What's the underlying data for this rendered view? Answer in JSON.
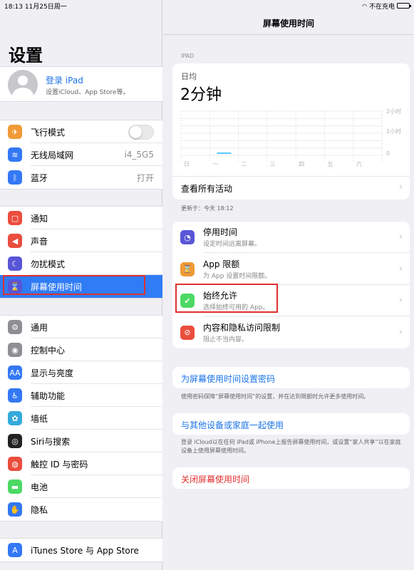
{
  "statusbar": {
    "time": "18:13",
    "date": "11月25日周一",
    "charging": "不在充电"
  },
  "sidebar": {
    "title": "设置",
    "profile": {
      "name": "登录 iPad",
      "subtitle": "设置iCloud、App Store等。"
    },
    "groups": [
      [
        {
          "label": "飞行模式",
          "icon": "airplane-icon",
          "color": "#f09a37",
          "glyph": "✈",
          "toggle": true
        },
        {
          "label": "无线局域网",
          "icon": "wifi-icon",
          "color": "#3478f6",
          "glyph": "≋",
          "value": "i4_5G5"
        },
        {
          "label": "蓝牙",
          "icon": "bluetooth-icon",
          "color": "#3478f6",
          "glyph": "ᛒ",
          "value": "打开"
        }
      ],
      [
        {
          "label": "通知",
          "icon": "notification-icon",
          "color": "#eb4d3d",
          "glyph": "▢"
        },
        {
          "label": "声音",
          "icon": "sound-icon",
          "color": "#eb4d3d",
          "glyph": "◀"
        },
        {
          "label": "勿扰模式",
          "icon": "moon-icon",
          "color": "#5856d6",
          "glyph": "☾"
        },
        {
          "label": "屏幕使用时间",
          "icon": "hourglass-icon",
          "color": "#5856d6",
          "glyph": "⌛",
          "selected": true
        }
      ],
      [
        {
          "label": "通用",
          "icon": "gear-icon",
          "color": "#8e8e93",
          "glyph": "⚙"
        },
        {
          "label": "控制中心",
          "icon": "control-center-icon",
          "color": "#8e8e93",
          "glyph": "◉"
        },
        {
          "label": "显示与亮度",
          "icon": "display-icon",
          "color": "#3478f6",
          "glyph": "AA"
        },
        {
          "label": "辅助功能",
          "icon": "accessibility-icon",
          "color": "#3478f6",
          "glyph": "♿"
        },
        {
          "label": "墙纸",
          "icon": "wallpaper-icon",
          "color": "#34aadc",
          "glyph": "✿"
        },
        {
          "label": "Siri与搜索",
          "icon": "siri-icon",
          "color": "#222222",
          "glyph": "◎"
        },
        {
          "label": "触控 ID 与密码",
          "icon": "fingerprint-icon",
          "color": "#eb4d3d",
          "glyph": "◍"
        },
        {
          "label": "电池",
          "icon": "battery-icon",
          "color": "#4cd964",
          "glyph": "▬"
        },
        {
          "label": "隐私",
          "icon": "hand-icon",
          "color": "#3478f6",
          "glyph": "✋"
        }
      ],
      [
        {
          "label": "iTunes Store 与 App Store",
          "icon": "app-store-icon",
          "color": "#3478f6",
          "glyph": "A"
        }
      ]
    ]
  },
  "main": {
    "title": "屏幕使用时间",
    "device_header": "IPAD",
    "daily_label": "日均",
    "daily_value": "2分钟",
    "see_all": "查看所有活动",
    "updated": "更新于：今天 18:12",
    "options": [
      {
        "title": "停用时间",
        "sub": "设定时间远离屏幕。",
        "icon": "downtime-icon",
        "color": "#5856d6",
        "glyph": "◔"
      },
      {
        "title": "App 限额",
        "sub": "为 App 设置时间限额。",
        "icon": "hourglass-icon",
        "color": "#f09a37",
        "glyph": "⌛"
      },
      {
        "title": "始终允许",
        "sub": "选择始终可用的 App。",
        "icon": "checkmark-icon",
        "color": "#4cd964",
        "glyph": "✔"
      },
      {
        "title": "内容和隐私访问限制",
        "sub": "阻止不当内容。",
        "icon": "restriction-icon",
        "color": "#eb4d3d",
        "glyph": "⊘"
      }
    ],
    "passcode_link": "为屏幕使用时间设置密码",
    "passcode_note": "使用密码保障“屏幕使用时间”的设置，并在达到限额时允许更多使用时间。",
    "share_link": "与其他设备或家庭一起使用",
    "share_note": "登录 iCloud以在任何 iPad或 iPhone上报告屏幕使用时间，或设置“家人共享”以在家庭设备上使用屏幕使用时间。",
    "turn_off": "关闭屏幕使用时间"
  },
  "chart_data": {
    "type": "bar",
    "categories": [
      "日",
      "一",
      "二",
      "三",
      "四",
      "五",
      "六"
    ],
    "values": [
      0,
      2,
      0,
      0,
      0,
      0,
      0
    ],
    "y_ticks": [
      "2小时",
      "1小时",
      "0"
    ],
    "ylim": [
      0,
      120
    ],
    "bar_color": "#5ac8fa"
  }
}
